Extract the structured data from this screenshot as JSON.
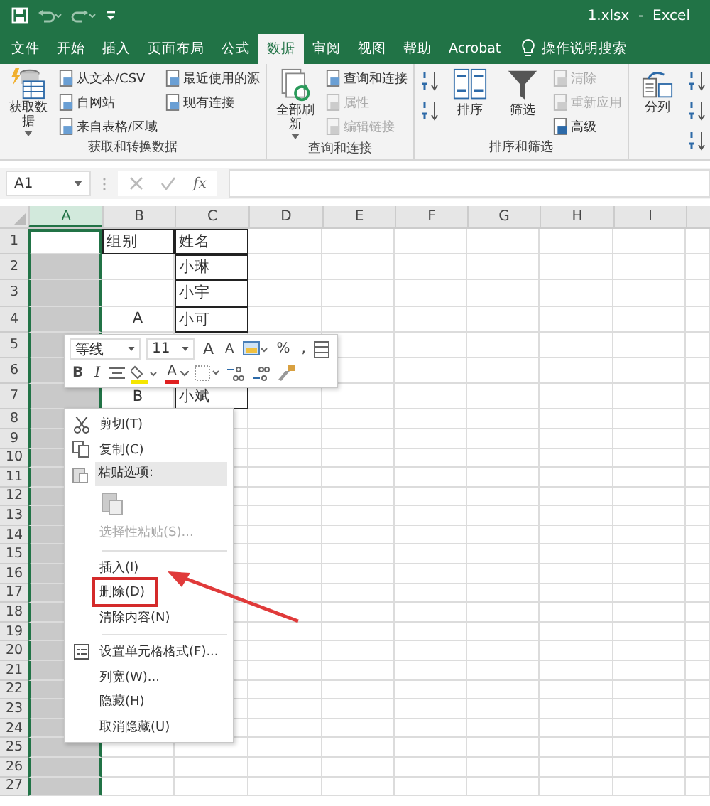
{
  "title_bar": {
    "title": "1.xlsx  -  Excel"
  },
  "tabs": [
    {
      "label": "文件",
      "selected": false
    },
    {
      "label": "开始",
      "selected": false
    },
    {
      "label": "插入",
      "selected": false
    },
    {
      "label": "页面布局",
      "selected": false
    },
    {
      "label": "公式",
      "selected": false
    },
    {
      "label": "数据",
      "selected": true
    },
    {
      "label": "审阅",
      "selected": false
    },
    {
      "label": "视图",
      "selected": false
    },
    {
      "label": "帮助",
      "selected": false
    },
    {
      "label": "Acrobat",
      "selected": false
    }
  ],
  "tell_me": {
    "placeholder": "操作说明搜索"
  },
  "ribbon": [
    {
      "label": "获取和转换数据",
      "columns": [
        [
          {
            "kind": "big",
            "label": "获取数据",
            "dropdown": true,
            "disabled": false
          }
        ],
        [
          {
            "kind": "small",
            "label": "从文本/CSV",
            "disabled": false
          },
          {
            "kind": "small",
            "label": "自网站",
            "disabled": false
          },
          {
            "kind": "small",
            "label": "来自表格/区域",
            "disabled": false
          }
        ],
        [
          {
            "kind": "small",
            "label": "最近使用的源",
            "disabled": false
          },
          {
            "kind": "small",
            "label": "现有连接",
            "disabled": false
          }
        ]
      ]
    },
    {
      "label": "查询和连接",
      "columns": [
        [
          {
            "kind": "big",
            "label": "全部刷新",
            "dropdown": true,
            "disabled": false
          }
        ],
        [
          {
            "kind": "small",
            "label": "查询和连接",
            "disabled": false
          },
          {
            "kind": "small",
            "label": "属性",
            "disabled": true
          },
          {
            "kind": "small",
            "label": "编辑链接",
            "disabled": true
          }
        ]
      ]
    },
    {
      "label": "排序和筛选",
      "columns": [
        [
          {
            "kind": "icon",
            "disabled": false
          },
          {
            "kind": "icon",
            "disabled": false
          }
        ],
        [
          {
            "kind": "big",
            "label": "排序",
            "dropdown": false,
            "disabled": false
          }
        ],
        [
          {
            "kind": "big",
            "label": "筛选",
            "dropdown": false,
            "disabled": false
          }
        ],
        [
          {
            "kind": "small",
            "label": "清除",
            "disabled": true
          },
          {
            "kind": "small",
            "label": "重新应用",
            "disabled": true
          },
          {
            "kind": "small",
            "label": "高级",
            "disabled": false
          }
        ]
      ]
    },
    {
      "columns": [
        [
          {
            "kind": "big",
            "label": "分列",
            "dropdown": false,
            "disabled": false
          }
        ],
        [
          {
            "kind": "icon",
            "disabled": false
          },
          {
            "kind": "icon",
            "disabled": false
          },
          {
            "kind": "icon",
            "disabled": false
          }
        ]
      ]
    }
  ],
  "formula_bar": {
    "name_box": "A1",
    "function_label": "fx"
  },
  "columns": [
    {
      "label": "A",
      "selected": true
    },
    {
      "label": "B",
      "selected": false
    },
    {
      "label": "C",
      "selected": false
    },
    {
      "label": "D",
      "selected": false
    },
    {
      "label": "E",
      "selected": false
    },
    {
      "label": "F",
      "selected": false
    },
    {
      "label": "G",
      "selected": false
    },
    {
      "label": "H",
      "selected": false
    },
    {
      "label": "I",
      "selected": false
    }
  ],
  "rows": [
    {
      "label": "1",
      "cells": [
        null,
        {
          "text": "组别",
          "bordered": true
        },
        {
          "text": "姓名",
          "bordered": true
        }
      ]
    },
    {
      "label": "2",
      "cells": [
        null,
        null,
        {
          "text": "小琳",
          "bordered": true
        }
      ]
    },
    {
      "label": "3",
      "cells": [
        null,
        null,
        {
          "text": "小宇",
          "bordered": true
        }
      ]
    },
    {
      "label": "4",
      "cells": [
        null,
        {
          "text": "A",
          "bordered": false
        },
        {
          "text": "小可",
          "bordered": true
        }
      ]
    },
    {
      "label": "5",
      "cells": []
    },
    {
      "label": "6",
      "cells": []
    },
    {
      "label": "7",
      "cells": [
        null,
        {
          "text": "B",
          "bordered": false
        },
        {
          "text": "小斌",
          "bordered": true
        }
      ]
    },
    {
      "label": "8",
      "cells": []
    },
    {
      "label": "9",
      "cells": []
    },
    {
      "label": "10",
      "cells": []
    },
    {
      "label": "11",
      "cells": []
    },
    {
      "label": "12",
      "cells": []
    },
    {
      "label": "13",
      "cells": []
    },
    {
      "label": "14",
      "cells": []
    },
    {
      "label": "15",
      "cells": []
    },
    {
      "label": "16",
      "cells": []
    },
    {
      "label": "17",
      "cells": []
    },
    {
      "label": "18",
      "cells": []
    },
    {
      "label": "19",
      "cells": []
    },
    {
      "label": "20",
      "cells": []
    },
    {
      "label": "21",
      "cells": []
    },
    {
      "label": "22",
      "cells": []
    },
    {
      "label": "23",
      "cells": []
    },
    {
      "label": "24",
      "cells": []
    },
    {
      "label": "25",
      "cells": []
    },
    {
      "label": "26",
      "cells": []
    },
    {
      "label": "27",
      "cells": []
    }
  ],
  "mini_toolbar": {
    "row_1": [
      {
        "kind": "font",
        "value": "等线"
      },
      {
        "kind": "size",
        "value": "11"
      },
      {
        "kind": "grow",
        "label": "A"
      },
      {
        "kind": "shrink",
        "label": "A"
      },
      {
        "kind": "styles"
      },
      {
        "kind": "percent",
        "label": "%"
      },
      {
        "kind": "comma",
        "label": ","
      },
      {
        "kind": "table"
      }
    ],
    "row_2": [
      {
        "kind": "bold",
        "label": "B"
      },
      {
        "kind": "italic",
        "label": "I"
      },
      {
        "kind": "align"
      },
      {
        "kind": "fill"
      },
      {
        "kind": "fontcolor",
        "label": "A"
      },
      {
        "kind": "borders"
      },
      {
        "kind": "incdec"
      },
      {
        "kind": "decdec"
      },
      {
        "kind": "brush"
      }
    ]
  },
  "context_menu": [
    {
      "kind": "item",
      "label": "剪切(T)",
      "disabled": false,
      "highlighted": false
    },
    {
      "kind": "item",
      "label": "复制(C)",
      "disabled": false,
      "highlighted": false
    },
    {
      "kind": "header",
      "label": "粘贴选项:"
    },
    {
      "kind": "paste"
    },
    {
      "kind": "item",
      "label": "选择性粘贴(S)...",
      "disabled": true,
      "highlighted": false
    },
    {
      "kind": "separator"
    },
    {
      "kind": "item",
      "label": "插入(I)",
      "disabled": false,
      "highlighted": false
    },
    {
      "kind": "item",
      "label": "删除(D)",
      "disabled": false,
      "highlighted": true
    },
    {
      "kind": "item",
      "label": "清除内容(N)",
      "disabled": false,
      "highlighted": false
    },
    {
      "kind": "separator"
    },
    {
      "kind": "item",
      "label": "设置单元格格式(F)...",
      "disabled": false,
      "highlighted": false
    },
    {
      "kind": "item",
      "label": "列宽(W)...",
      "disabled": false,
      "highlighted": false
    },
    {
      "kind": "item",
      "label": "隐藏(H)",
      "disabled": false,
      "highlighted": false
    },
    {
      "kind": "item",
      "label": "取消隐藏(U)",
      "disabled": false,
      "highlighted": false
    }
  ],
  "annotations": [
    {
      "kind": "arrow"
    }
  ]
}
